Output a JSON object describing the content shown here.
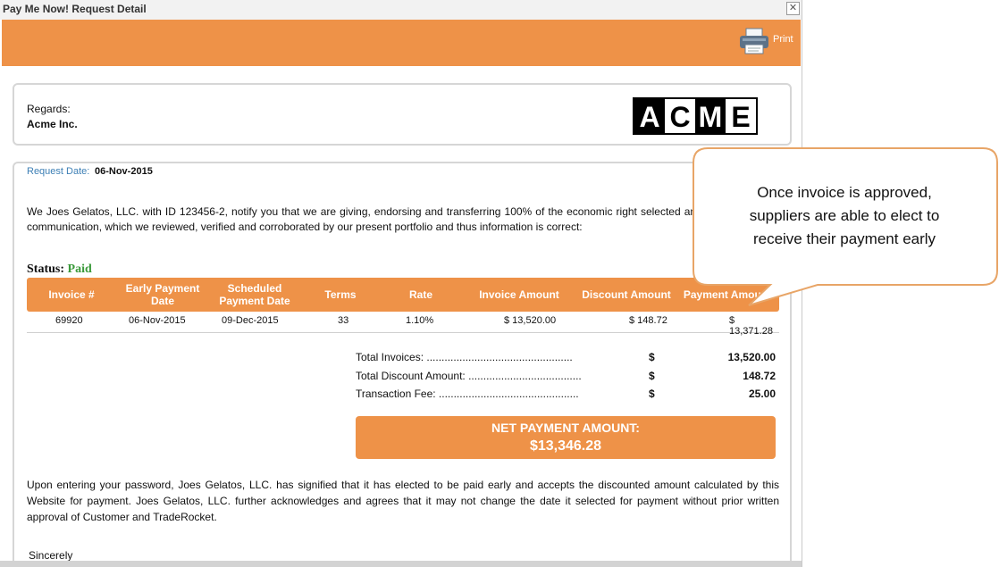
{
  "window": {
    "title": "Pay Me Now! Request Detail",
    "close_symbol": "✕"
  },
  "toolbar": {
    "print_label": "Print",
    "icon": "printer-icon",
    "color": "#ee9248"
  },
  "header": {
    "regards_label": "Regards:",
    "company_name": "Acme Inc.",
    "logo_text": "ACME"
  },
  "request": {
    "date_label": "Request Date:",
    "date_value": "06-Nov-2015"
  },
  "notice": {
    "intro": "We Joes Gelatos, LLC. with ID 123456-2, notify you that we are giving, endorsing and transferring 100% of the economic right selected and listed in this communication, which we reviewed, verified and corroborated by our present portfolio and thus information is correct:",
    "status_label": "Status:",
    "status_value": "Paid"
  },
  "table": {
    "headers": [
      "Invoice #",
      "Early Payment Date",
      "Scheduled Payment Date",
      "Terms",
      "Rate",
      "Invoice Amount",
      "Discount Amount",
      "Payment Amount"
    ],
    "rows": [
      [
        "69920",
        "06-Nov-2015",
        "09-Dec-2015",
        "33",
        "1.10%",
        "$ 13,520.00",
        "$ 148.72",
        "$ 13,371.28"
      ]
    ]
  },
  "summary": {
    "total_invoices_label": "Total Invoices: .................................................",
    "total_discount_label": "Total Discount Amount: ......................................",
    "transaction_fee_label": "Transaction Fee: ...............................................",
    "currency": "$",
    "total_invoices": "13,520.00",
    "total_discount": "148.72",
    "transaction_fee": "25.00"
  },
  "net_payment": {
    "label": "NET PAYMENT AMOUNT:",
    "value": "$13,346.28"
  },
  "footer": {
    "text": "Upon entering your password, Joes Gelatos, LLC. has signified that it has elected to be paid early and accepts the discounted amount calculated by this Website for payment. Joes Gelatos, LLC. further acknowledges and agrees that it may not change the date it selected for payment without prior written approval of Customer and TradeRocket.",
    "closing": "Sincerely"
  },
  "callout": {
    "lines": [
      "Once invoice is approved,",
      "suppliers are able to elect to",
      "receive their payment early"
    ],
    "border_color": "#e8a567"
  }
}
